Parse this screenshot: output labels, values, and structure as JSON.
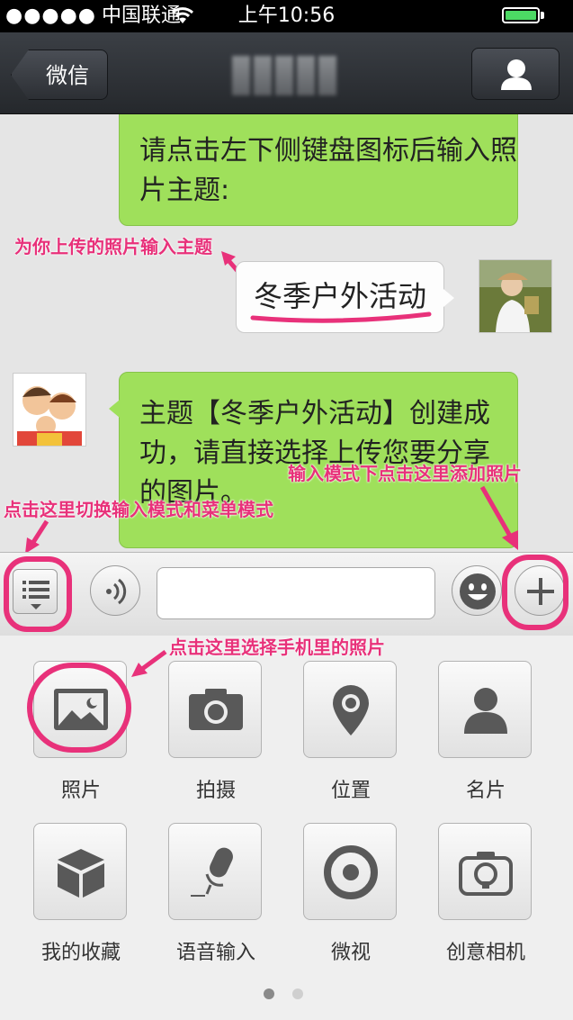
{
  "status_bar": {
    "signal_dots": "●●●●●",
    "carrier": "中国联通",
    "time": "上午10:56"
  },
  "nav": {
    "back_label": "微信",
    "profile_icon": "person-icon"
  },
  "chat": {
    "messages": [
      {
        "from": "other",
        "text": "请点击左下侧键盘图标后输入照片主题:"
      },
      {
        "from": "me",
        "text": "冬季户外活动"
      },
      {
        "from": "other",
        "text": "主题【冬季户外活动】创建成功，请直接选择上传您要分享的图片。"
      }
    ]
  },
  "annotations": {
    "enter_topic": "为你上传的照片输入主题",
    "add_photo": "输入模式下点击这里添加照片",
    "switch_mode": "点击这里切换输入模式和菜单模式",
    "choose_photo": "点击这里选择手机里的照片"
  },
  "panel": {
    "items": [
      {
        "label": "照片",
        "icon": "photo-icon"
      },
      {
        "label": "拍摄",
        "icon": "camera-icon"
      },
      {
        "label": "位置",
        "icon": "location-pin-icon"
      },
      {
        "label": "名片",
        "icon": "contact-card-icon"
      },
      {
        "label": "我的收藏",
        "icon": "favorites-box-icon"
      },
      {
        "label": "语音输入",
        "icon": "microphone-icon"
      },
      {
        "label": "微视",
        "icon": "weishi-icon"
      },
      {
        "label": "创意相机",
        "icon": "creative-camera-icon"
      }
    ],
    "page_count": 2,
    "current_page": 1
  },
  "colors": {
    "bubble_green": "#9fe05b",
    "annotation_pink": "#e8317a",
    "battery_green": "#4cd964"
  }
}
